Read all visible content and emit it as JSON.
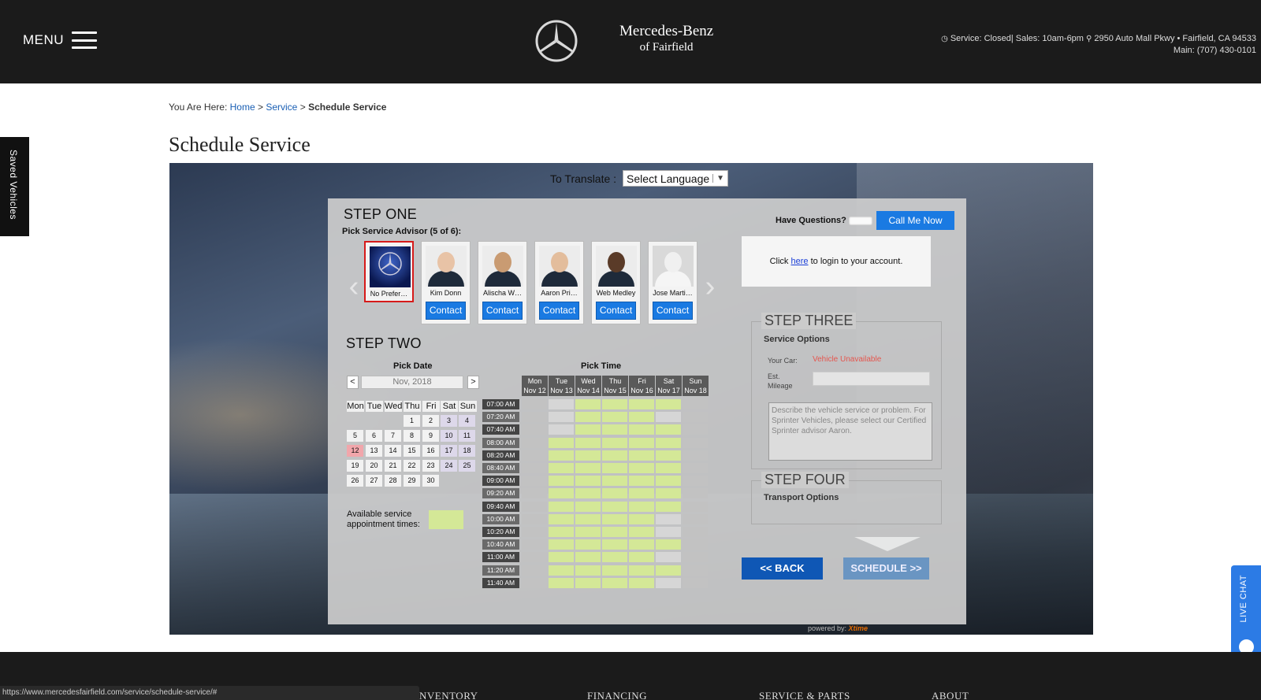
{
  "header": {
    "menu_label": "MENU",
    "brand_name": "Mercedes-Benz",
    "brand_sub": "of Fairfield",
    "hours": "Service: Closed| Sales: 10am-6pm",
    "address": "2950 Auto Mall Pkwy • Fairfield, CA 94533",
    "phone": "Main: (707) 430-0101"
  },
  "breadcrumb": {
    "prefix": "You Are Here:",
    "home": "Home",
    "service": "Service",
    "current": "Schedule Service",
    "sep": ">"
  },
  "page_title": "Schedule Service",
  "saved_tab": "Saved Vehicles",
  "translate": {
    "label": "To Translate :",
    "select_value": "Select Language"
  },
  "step_one": {
    "title": "STEP ONE",
    "subtitle": "Pick Service Advisor (5 of 6):",
    "advisors": [
      {
        "name": "No Prefer…",
        "selected": true,
        "contact": ""
      },
      {
        "name": "Kim Donn",
        "selected": false,
        "contact": "Contact"
      },
      {
        "name": "Alischa W…",
        "selected": false,
        "contact": "Contact"
      },
      {
        "name": "Aaron Pri…",
        "selected": false,
        "contact": "Contact"
      },
      {
        "name": "Web Medley",
        "selected": false,
        "contact": "Contact"
      },
      {
        "name": "Jose Marti…",
        "selected": false,
        "contact": "Contact"
      }
    ],
    "questions_label": "Have Questions?",
    "call_button": "Call Me Now",
    "login_prefix": "Click",
    "login_link": "here",
    "login_suffix": "to login to your account."
  },
  "step_two": {
    "title": "STEP TWO",
    "pick_date": "Pick Date",
    "pick_time": "Pick Time",
    "prev": "<",
    "next": ">",
    "month": "Nov, 2018",
    "weekdays": [
      "Mon",
      "Tue",
      "Wed",
      "Thu",
      "Fri",
      "Sat",
      "Sun"
    ],
    "weeks": [
      [
        "",
        "",
        "",
        "1",
        "2",
        "3",
        "4"
      ],
      [
        "5",
        "6",
        "7",
        "8",
        "9",
        "10",
        "11"
      ],
      [
        "12",
        "13",
        "14",
        "15",
        "16",
        "17",
        "18"
      ],
      [
        "19",
        "20",
        "21",
        "22",
        "23",
        "24",
        "25"
      ],
      [
        "26",
        "27",
        "28",
        "29",
        "30",
        "",
        ""
      ]
    ],
    "selected_date": "12",
    "legend": [
      "Available service",
      "appointment times:"
    ],
    "days": [
      {
        "day": "Mon",
        "date": "Nov 12"
      },
      {
        "day": "Tue",
        "date": "Nov 13"
      },
      {
        "day": "Wed",
        "date": "Nov 14"
      },
      {
        "day": "Thu",
        "date": "Nov 15"
      },
      {
        "day": "Fri",
        "date": "Nov 16"
      },
      {
        "day": "Sat",
        "date": "Nov 17"
      },
      {
        "day": "Sun",
        "date": "Nov 18"
      }
    ],
    "times": [
      "07:00 AM",
      "07:20 AM",
      "07:40 AM",
      "08:00 AM",
      "08:20 AM",
      "08:40 AM",
      "09:00 AM",
      "09:20 AM",
      "09:40 AM",
      "10:00 AM",
      "10:20 AM",
      "10:40 AM",
      "11:00 AM",
      "11:20 AM",
      "11:40 AM"
    ],
    "availability": [
      [
        0,
        0,
        1,
        1,
        1,
        1,
        0
      ],
      [
        0,
        0,
        1,
        1,
        1,
        0,
        0
      ],
      [
        0,
        0,
        1,
        1,
        1,
        1,
        0
      ],
      [
        0,
        1,
        1,
        1,
        1,
        1,
        0
      ],
      [
        0,
        1,
        1,
        1,
        1,
        1,
        0
      ],
      [
        0,
        1,
        1,
        1,
        1,
        1,
        0
      ],
      [
        0,
        1,
        1,
        1,
        1,
        1,
        0
      ],
      [
        0,
        1,
        1,
        1,
        1,
        1,
        0
      ],
      [
        0,
        1,
        1,
        1,
        1,
        1,
        0
      ],
      [
        0,
        1,
        1,
        1,
        1,
        0,
        0
      ],
      [
        0,
        1,
        1,
        1,
        1,
        0,
        0
      ],
      [
        0,
        1,
        1,
        1,
        1,
        1,
        0
      ],
      [
        0,
        1,
        1,
        1,
        1,
        0,
        0
      ],
      [
        0,
        1,
        1,
        1,
        1,
        1,
        0
      ],
      [
        0,
        1,
        1,
        1,
        1,
        0,
        0
      ]
    ],
    "colors": {
      "available": "#d4e897",
      "unavailable": "#c2c2c2",
      "unavailable_alt": "#d6d6d6"
    }
  },
  "step_three": {
    "title": "STEP THREE",
    "subtitle": "Service Options",
    "your_car_label": "Your Car:",
    "vehicle_status": "Vehicle Unavailable",
    "mileage_label_1": "Est.",
    "mileage_label_2": "Mileage",
    "description_placeholder": "Describe the vehicle service or problem. For Sprinter Vehicles, please select our Certified Sprinter advisor Aaron."
  },
  "step_four": {
    "title": "STEP FOUR",
    "subtitle": "Transport Options"
  },
  "actions": {
    "back": "<< BACK",
    "schedule": "SCHEDULE >>"
  },
  "powered_by": {
    "label": "powered by:",
    "brand": "Xtime"
  },
  "live_chat": "LIVE CHAT",
  "footer": {
    "links": [
      "NVENTORY",
      "FINANCING",
      "SERVICE & PARTS",
      "ABOUT"
    ]
  },
  "status_url": "https://www.mercedesfairfield.com/service/schedule-service/#"
}
